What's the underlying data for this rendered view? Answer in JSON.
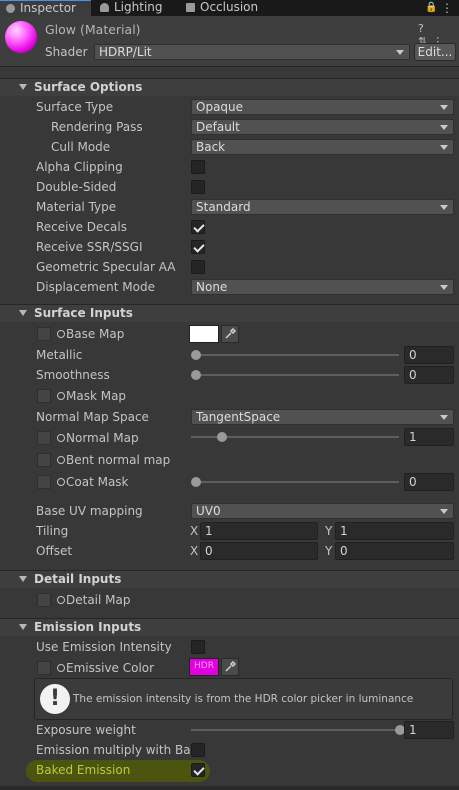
{
  "tabs": [
    {
      "label": "Inspector",
      "icon": "info-icon"
    },
    {
      "label": "Lighting",
      "icon": "bulb-icon"
    },
    {
      "label": "Occlusion",
      "icon": "occlusion-icon"
    }
  ],
  "header": {
    "title": "Glow (Material)",
    "shader_label": "Shader",
    "shader_value": "HDRP/Lit",
    "edit_label": "Edit..."
  },
  "surface_options": {
    "title": "Surface Options",
    "surface_type": {
      "label": "Surface Type",
      "value": "Opaque"
    },
    "rendering_pass": {
      "label": "Rendering Pass",
      "value": "Default"
    },
    "cull_mode": {
      "label": "Cull Mode",
      "value": "Back"
    },
    "alpha_clipping": {
      "label": "Alpha Clipping",
      "checked": false
    },
    "double_sided": {
      "label": "Double-Sided",
      "checked": false
    },
    "material_type": {
      "label": "Material Type",
      "value": "Standard"
    },
    "receive_decals": {
      "label": "Receive Decals",
      "checked": true
    },
    "receive_ssr": {
      "label": "Receive SSR/SSGI",
      "checked": true
    },
    "geometric_aa": {
      "label": "Geometric Specular AA",
      "checked": false
    },
    "displacement": {
      "label": "Displacement Mode",
      "value": "None"
    }
  },
  "surface_inputs": {
    "title": "Surface Inputs",
    "base_map": {
      "label": "Base Map",
      "color": "#ffffff"
    },
    "metallic": {
      "label": "Metallic",
      "value": "0",
      "fraction": 0
    },
    "smoothness": {
      "label": "Smoothness",
      "value": "0",
      "fraction": 0
    },
    "mask_map": {
      "label": "Mask Map"
    },
    "normal_map_space": {
      "label": "Normal Map Space",
      "value": "TangentSpace"
    },
    "normal_map": {
      "label": "Normal Map",
      "value": "1",
      "fraction": 0.125
    },
    "bent_normal_map": {
      "label": "Bent normal map"
    },
    "coat_mask": {
      "label": "Coat Mask",
      "value": "0",
      "fraction": 0
    },
    "base_uv": {
      "label": "Base UV mapping",
      "value": "UV0"
    },
    "tiling": {
      "label": "Tiling",
      "x_label": "X",
      "x": "1",
      "y_label": "Y",
      "y": "1"
    },
    "offset": {
      "label": "Offset",
      "x_label": "X",
      "x": "0",
      "y_label": "Y",
      "y": "0"
    }
  },
  "detail_inputs": {
    "title": "Detail Inputs",
    "detail_map": {
      "label": "Detail Map"
    }
  },
  "emission_inputs": {
    "title": "Emission Inputs",
    "use_intensity": {
      "label": "Use Emission Intensity",
      "checked": false
    },
    "emissive_color": {
      "label": "Emissive Color",
      "color": "#e000e0",
      "hdr_label": "HDR"
    },
    "help_text": "The emission intensity is from the HDR color picker in luminance",
    "exposure_weight": {
      "label": "Exposure weight",
      "value": "1",
      "fraction": 1
    },
    "multiply_base": {
      "label": "Emission multiply with Base",
      "checked": false
    },
    "baked_emission": {
      "label": "Baked Emission",
      "checked": true
    }
  },
  "colors": {
    "accent_tab": "#4a8ef0",
    "highlight": "#566200"
  }
}
